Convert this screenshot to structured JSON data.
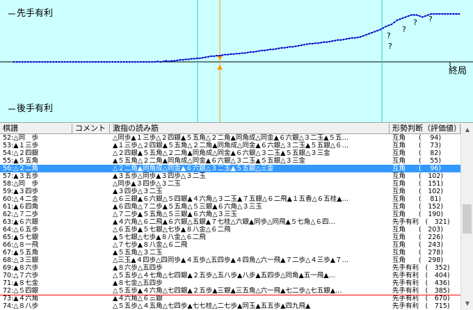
{
  "graph": {
    "top_label": "先手有利",
    "bottom_label": "後手有利",
    "end_label": "終局",
    "colors": {
      "background": "#ccffff",
      "line": "#0000cc",
      "marker": "#ff9900",
      "vline": "#33cccc"
    },
    "chart_data": {
      "type": "line",
      "series": [
        {
          "values": [
            0,
            0,
            0,
            0,
            0,
            0,
            0,
            0,
            0,
            0,
            0,
            0,
            0,
            0,
            0,
            0,
            0,
            0,
            0,
            0,
            0,
            0,
            0,
            0,
            0,
            0,
            0,
            0,
            0,
            0,
            0,
            0,
            0,
            0,
            0,
            0,
            0,
            0,
            0,
            0,
            0,
            0,
            0,
            0,
            0,
            0,
            0,
            0,
            0,
            0,
            0,
            1,
            0,
            1,
            2,
            1,
            2,
            2,
            3,
            4,
            4,
            5,
            5,
            6,
            6,
            7,
            7,
            8,
            9,
            10,
            11,
            11,
            12,
            12,
            13,
            14,
            14,
            15,
            15,
            16,
            16,
            17,
            17,
            18,
            19,
            19,
            20,
            21,
            22,
            22,
            23,
            24,
            24,
            25,
            26,
            27,
            27,
            28,
            29,
            29,
            30,
            31,
            32,
            33,
            34,
            35,
            35,
            36,
            36,
            37,
            38,
            38,
            39,
            40,
            41,
            42,
            42,
            43,
            44,
            45,
            46,
            46,
            47,
            48,
            50,
            52,
            54,
            56,
            58,
            60,
            62,
            65,
            68,
            70,
            72,
            76,
            80,
            82,
            84,
            86,
            88,
            90,
            90,
            90,
            88,
            86,
            88,
            90,
            92,
            92,
            92,
            92,
            92,
            92,
            92,
            92,
            92,
            92,
            92
          ]
        }
      ]
    }
  },
  "table": {
    "headers": {
      "move": "棋譜",
      "comment": "コメント",
      "line": "激指の読み筋",
      "eval": "形勢判断（評価値）"
    },
    "rows": [
      {
        "move": "52:△同　歩",
        "line": "△同歩▲１三歩△２四銀▲５五角△２二角▲同角成△同金▲６六銀△３二玉▲５五…",
        "eval": "互角　　(　 94)"
      },
      {
        "move": "53:▲１三歩",
        "line": "▲１三歩△２四銀▲５五角△２二角▲同角成△同金▲６六銀△３二玉▲５五銀△６…",
        "eval": "互角　　(　 73)"
      },
      {
        "move": "54:△２四銀",
        "line": "△２四銀▲５五角△２二角▲同角成△同金▲６六銀△３二玉▲５五銀△３三金",
        "eval": "互角　　(　 82)"
      },
      {
        "move": "55:▲５五角",
        "line": "▲５五角△２二角▲同角成△同金▲６六銀△３二玉▲５五銀△３三金",
        "eval": "互角　　(　 55)"
      },
      {
        "move": "56:△２二角",
        "line": "△２二角▲同角成△同金▲６六銀△３二玉▲５五銀△三金",
        "eval": "互角　　(　 96)"
      },
      {
        "move": "57:▲３五歩",
        "line": "▲３五歩△同歩▲３四歩△３二玉",
        "eval": "互角　　(　102)"
      },
      {
        "move": "58:△同　歩",
        "line": "△同歩▲３四歩△３二玉",
        "eval": "互角　　(　151)"
      },
      {
        "move": "59:▲３四歩",
        "line": "▲３四歩△３二玉",
        "eval": "互角　　(　102)"
      },
      {
        "move": "60:△４二金",
        "line": "△６三銀▲６六銀△５四銀▲４六角△３二玉▲７五銀△６二飛▲１五香△６五桂▲…",
        "eval": "互角　　(　 81)"
      },
      {
        "move": "61:▲６四角",
        "line": "▲６四角△７二歩▲５五角△５三銀▲６六角△３三玉",
        "eval": "互角　　(　152)"
      },
      {
        "move": "62:△７二歩",
        "line": "△７二歩▲５五角△５三銀▲６六角△３三玉",
        "eval": "互角　　(　190)"
      },
      {
        "move": "63:▲６六銀",
        "line": "▲４六角△６二飛▲６六銀△五銀▲７七桂△六銀▲同歩△同飛▲５七角△６四…",
        "eval": "先手有利　(　321)"
      },
      {
        "move": "64:△６五歩",
        "line": "△６五歩▲５七銀△七歩▲８八金△６二飛",
        "eval": "互角　　(　203)"
      },
      {
        "move": "65:▲５七銀",
        "line": "▲５七銀△七歩▲８八金△６二飛",
        "eval": "互角　　(　226)"
      },
      {
        "move": "66:△８一飛",
        "line": "△７七歩▲８八金△６二飛",
        "eval": "互角　　(　243)"
      },
      {
        "move": "67:▲５五角",
        "line": "▲５五角△３二玉",
        "eval": "互角　　(　278)"
      },
      {
        "move": "68:△３三銀",
        "line": "△三玉▲４四歩△四同歩▲４五歩△五四歩▲４四角△六一飛▲７二歩△４三歩▲７…",
        "eval": "互角　　(　298)"
      },
      {
        "move": "69:▲８六歩",
        "line": "▲８六歩△五四歩",
        "eval": "先手有利　(　352)"
      },
      {
        "move": "70:△７六歩",
        "line": "△５五歩△４七角△七四銀▲２五歩△五八歩▲八步▲五四歩△同角▲五一飛▲…",
        "eval": "先手有利　(　404)"
      },
      {
        "move": "71:▲８七金",
        "line": "▲８七金△五四歩",
        "eval": "先手有利　(　436)"
      },
      {
        "move": "72:△５四銀",
        "line": "△５五歩▲４六角△七四銀▲２五歩▲三銀▲三五角△六一飛▲七二歩△七五銀▲…",
        "eval": "先手有利　(　385)"
      },
      {
        "move": "73:▲４六角",
        "line": "▲４六角△６三銀",
        "eval": "先手有利　(　670)"
      },
      {
        "move": "74:△８八歩",
        "line": "△５五歩△４五角△七四歩▲七七桂△二七歩▲同玉▲五五歩▲四九飛▲",
        "eval": "先手有利　(　715)"
      }
    ]
  }
}
